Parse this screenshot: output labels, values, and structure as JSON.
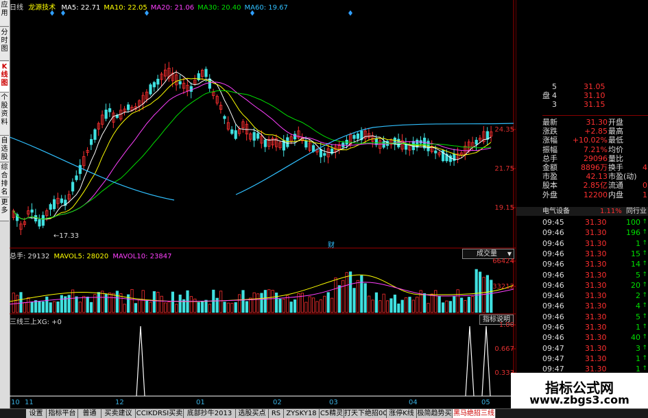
{
  "sidebar": {
    "tabs": [
      {
        "label": "应用",
        "active": false
      },
      {
        "label": "分时图",
        "active": false
      },
      {
        "label": "K线图",
        "active": true
      },
      {
        "label": "个股资料",
        "active": false
      },
      {
        "label": "自选股",
        "active": false
      },
      {
        "label": "综合排名",
        "active": false
      },
      {
        "label": "更多",
        "active": false
      }
    ]
  },
  "price_panel": {
    "period": "日线",
    "stock_name": "龙源技术",
    "ma": [
      {
        "label": "MA5: 22.71",
        "color": "#ffffff"
      },
      {
        "label": "MA10: 22.05",
        "color": "#ffff00"
      },
      {
        "label": "MA20: 21.06",
        "color": "#ff40ff"
      },
      {
        "label": "MA30: 20.40",
        "color": "#00e000"
      },
      {
        "label": "MA60: 19.67",
        "color": "#30c0ff"
      }
    ],
    "y_ticks": [
      "24.35",
      "21.75",
      "19.15"
    ],
    "low_marker": "←17.33",
    "event_marker": "财"
  },
  "volume_panel": {
    "label": "总手: 29132",
    "mavol5": "MAVOL5: 28020",
    "mavol10": "MAVOL10: 23847",
    "dropdown": "成交量",
    "y_ticks": [
      "66424",
      "33212"
    ]
  },
  "indicator_panel": {
    "label": "三线三上XG: +0",
    "button": "指标说明",
    "y_ticks": [
      "1.00",
      "0.667",
      "0.333"
    ]
  },
  "x_axis": {
    "labels": [
      "10",
      "11",
      "12",
      "01",
      "02",
      "03",
      "04",
      "05"
    ]
  },
  "quote": {
    "order_book": [
      {
        "side": "",
        "level": "5",
        "price": "31.05"
      },
      {
        "side": "盘",
        "level": "4",
        "price": "31.10"
      },
      {
        "side": "",
        "level": "3",
        "price": "31.15"
      }
    ],
    "stats": [
      {
        "l1": "最新",
        "v1": "31.30",
        "l2": "开盘",
        "v2": ""
      },
      {
        "l1": "涨跌",
        "v1": "+2.85",
        "l2": "最高",
        "v2": ""
      },
      {
        "l1": "涨幅",
        "v1": "+10.02%",
        "l2": "最低",
        "v2": ""
      },
      {
        "l1": "振幅",
        "v1": "7.21%",
        "l2": "均价",
        "v2": ""
      },
      {
        "l1": "总手",
        "v1": "29096",
        "l2": "量比",
        "v2": ""
      },
      {
        "l1": "金额",
        "v1": "8896万",
        "l2": "换手",
        "v2": "4"
      },
      {
        "l1": "市盈",
        "v1": "42.13",
        "l2": "市盈(动)",
        "v2": ""
      },
      {
        "l1": "股本",
        "v1": "2.85亿",
        "l2": "流通",
        "v2": "0"
      },
      {
        "l1": "外盘",
        "v1": "12200",
        "l2": "内盘",
        "v2": "1"
      }
    ],
    "sector": {
      "name": "电气设备",
      "change": "1.11%",
      "compare": "同行业"
    },
    "ticks": [
      {
        "time": "09:45",
        "price": "31.30",
        "vol": "100",
        "dir": "up"
      },
      {
        "time": "09:46",
        "price": "31.30",
        "vol": "196",
        "dir": "up"
      },
      {
        "time": "09:46",
        "price": "31.30",
        "vol": "1",
        "dir": "up"
      },
      {
        "time": "09:46",
        "price": "31.30",
        "vol": "15",
        "dir": "up"
      },
      {
        "time": "09:46",
        "price": "31.30",
        "vol": "14",
        "dir": "up"
      },
      {
        "time": "09:46",
        "price": "31.30",
        "vol": "5",
        "dir": "up"
      },
      {
        "time": "09:46",
        "price": "31.30",
        "vol": "20",
        "dir": "up"
      },
      {
        "time": "09:46",
        "price": "31.30",
        "vol": "2",
        "dir": "up"
      },
      {
        "time": "09:46",
        "price": "31.30",
        "vol": "4",
        "dir": "up"
      },
      {
        "time": "09:46",
        "price": "31.30",
        "vol": "5",
        "dir": "up"
      },
      {
        "time": "09:46",
        "price": "31.30",
        "vol": "1",
        "dir": "up"
      },
      {
        "time": "09:46",
        "price": "31.30",
        "vol": "40",
        "dir": "up"
      },
      {
        "time": "09:47",
        "price": "31.30",
        "vol": "3",
        "dir": "up"
      },
      {
        "time": "09:47",
        "price": "31.30",
        "vol": "1",
        "dir": "up"
      },
      {
        "time": "09:47",
        "price": "31.30",
        "vol": "1",
        "dir": "up"
      },
      {
        "time": "09:47",
        "price": "31.30",
        "vol": "45",
        "dir": "up"
      },
      {
        "time": "09:47",
        "price": "31.30",
        "vol": "30",
        "dir": "up"
      },
      {
        "time": "09:47",
        "price": "31.30",
        "vol": "1",
        "dir": "up"
      }
    ]
  },
  "bottom_tabs": [
    {
      "label": "设置",
      "active": false
    },
    {
      "label": "指标平台",
      "active": false
    },
    {
      "label": "普通",
      "active": false
    },
    {
      "label": "买卖建议",
      "active": false
    },
    {
      "label": "CCIKDRSI买卖",
      "active": false
    },
    {
      "label": "底部抄牛2013",
      "active": false
    },
    {
      "label": "选股买点",
      "active": false
    },
    {
      "label": "RS",
      "active": false
    },
    {
      "label": "ZYSKY18",
      "active": false
    },
    {
      "label": "C5精灵",
      "active": false
    },
    {
      "label": "打天下绝招00",
      "active": false
    },
    {
      "label": "涨停K线",
      "active": false
    },
    {
      "label": "极简趋势买",
      "active": false
    },
    {
      "label": "黑马绝招三线",
      "active": true
    }
  ],
  "watermark": {
    "title": "指标公式网",
    "url": "www.zbgs3.com"
  },
  "colors": {
    "up": "#ff3030",
    "down": "#40e0e0",
    "axis": "#a00000",
    "ma5": "#ffffff",
    "ma10": "#ffff00",
    "ma20": "#ff40ff",
    "ma30": "#00e000",
    "ma60": "#30c0ff",
    "signal": "#ffffff"
  }
}
